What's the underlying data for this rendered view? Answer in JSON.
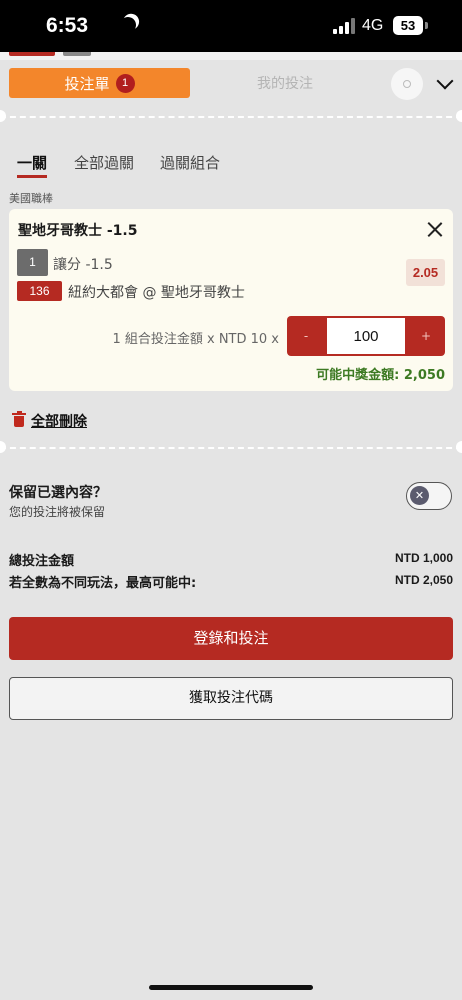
{
  "status_bar": {
    "time": "6:53",
    "network": "4G",
    "battery": "53"
  },
  "header": {
    "betslip_tab": "投注單",
    "betslip_count": "1",
    "mybets_tab": "我的投注"
  },
  "bet_tabs": [
    "一關",
    "全部過關",
    "過關組合"
  ],
  "league": "美國職棒",
  "bet": {
    "title": "聖地牙哥教士 -1.5",
    "market_number": "1",
    "market": "讓分 -1.5",
    "odds": "2.05",
    "event_id": "136",
    "matchup": "紐約大都會 @ 聖地牙哥教士",
    "stake_label": "1 組合投注金額 x NTD 10 x",
    "stake_minus": "-",
    "stake_value": "100",
    "stake_plus": "+",
    "potential_win": "可能中獎金額: 2,050"
  },
  "delete_all": "全部刪除",
  "keep": {
    "title": "保留已選內容？",
    "subtitle": "您的投注將被保留",
    "toggle_symbol": "✕",
    "enabled": false
  },
  "summary": {
    "total_label": "總投注金額",
    "total_value": "NTD 1,000",
    "maxwin_label": "若全數為不同玩法，最高可能中:",
    "maxwin_value": "NTD 2,050"
  },
  "buttons": {
    "login_bet": "登錄和投注",
    "get_code": "獲取投注代碼"
  },
  "colors": {
    "accent_orange": "#f3862b",
    "brand_red": "#b52a22",
    "win_green": "#3d7a23"
  }
}
